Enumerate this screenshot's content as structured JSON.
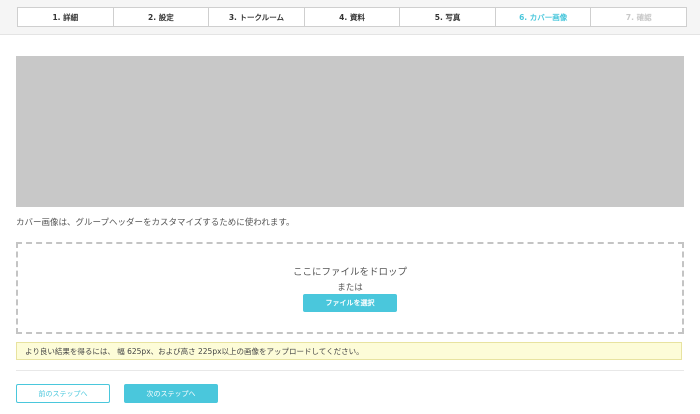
{
  "steps": [
    {
      "label": "1. 詳細"
    },
    {
      "label": "2. 設定"
    },
    {
      "label": "3. トークルーム"
    },
    {
      "label": "4. 資料"
    },
    {
      "label": "5. 写真"
    },
    {
      "label": "6. カバー画像"
    },
    {
      "label": "7. 確認"
    }
  ],
  "current_step": 6,
  "colors": {
    "accent": "#4ac7dc",
    "preview": "#c8c8c8",
    "notice_bg": "#fdfcd8"
  },
  "cover": {
    "description": "カバー画像は、グループヘッダーをカスタマイズするために使われます。"
  },
  "dropzone": {
    "drop_text": "ここにファイルをドロップ",
    "or_text": "または",
    "select_button": "ファイルを選択"
  },
  "notice": {
    "text": "より良い結果を得るには、 幅 625px、および高さ 225px以上の画像をアップロードしてください。"
  },
  "nav": {
    "prev_button": "前のステップへ",
    "next_button": "次のステップへ"
  }
}
